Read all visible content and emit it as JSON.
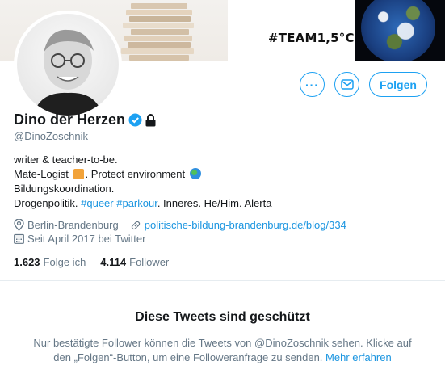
{
  "banner": {
    "text": "#TEAM1,5°C"
  },
  "profile": {
    "display_name": "Dino der Herzen",
    "handle": "@DinoZoschnik",
    "bio": {
      "line1": "writer & teacher-to-be.",
      "line2_a": "Mate-Logist",
      "line2_b": ". Protect environment",
      "line3": "Bildungskoordination.",
      "line4_a": "Drogenpolitik.",
      "line4_tag1": "#queer",
      "line4_tag2": "#parkour",
      "line4_b": ". Inneres. He/Him. Alerta"
    },
    "location": "Berlin-Brandenburg",
    "website": "politische-bildung-brandenburg.de/blog/334",
    "joined": "Seit April 2017 bei Twitter"
  },
  "actions": {
    "more_label": "···",
    "follow_label": "Folgen"
  },
  "counts": {
    "following_num": "1.623",
    "following_label": "Folge ich",
    "followers_num": "4.114",
    "followers_label": "Follower"
  },
  "protected": {
    "title": "Diese Tweets sind geschützt",
    "text_line1": "Nur bestätigte Follower können die Tweets von @DinoZoschnik sehen. Klicke auf",
    "text_line2": "den „Folgen“-Button, um eine Followeranfrage zu senden.",
    "learn_more": "Mehr erfahren"
  },
  "colors": {
    "accent": "#1da1f2",
    "secondary_text": "#657786"
  }
}
